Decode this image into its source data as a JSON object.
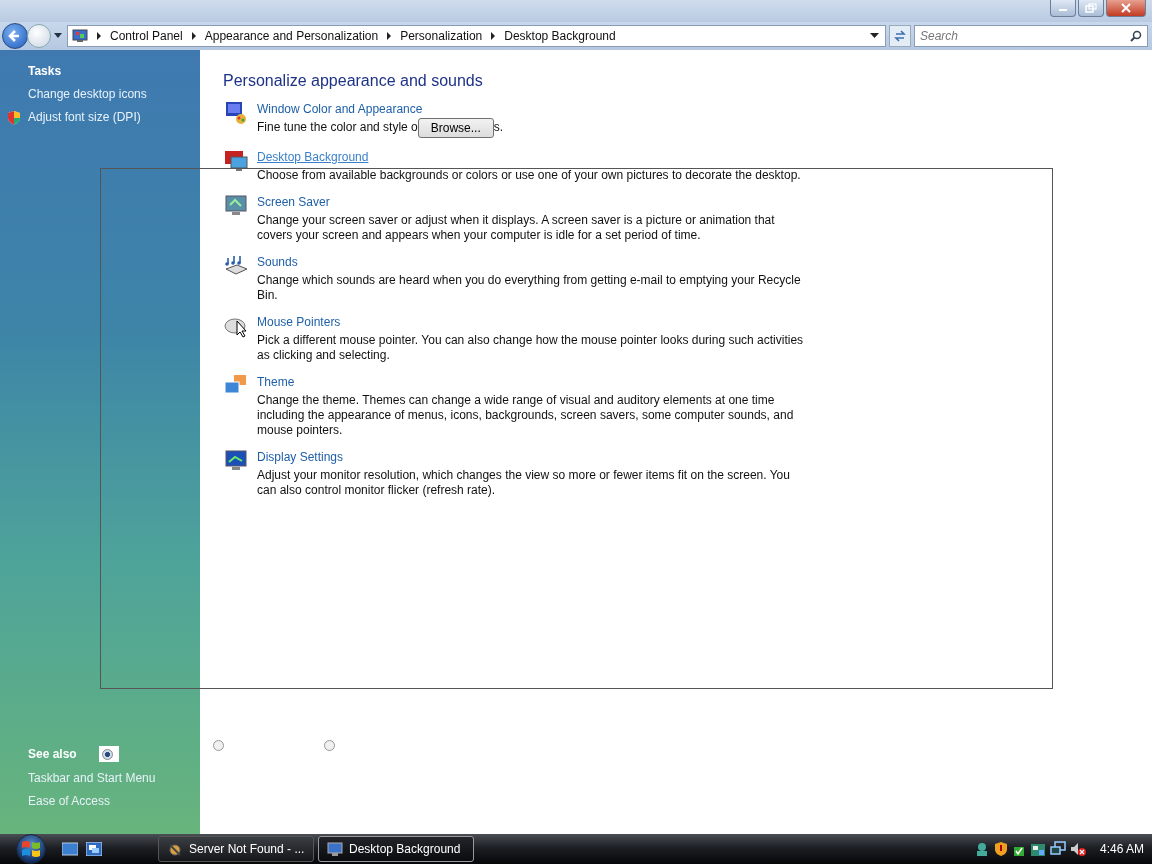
{
  "address_bar": {
    "crumbs": [
      "Control Panel",
      "Appearance and Personalization",
      "Personalization",
      "Desktop Background"
    ]
  },
  "search": {
    "placeholder": "Search"
  },
  "sidebar": {
    "tasks_title": "Tasks",
    "tasks": [
      {
        "label": "Change desktop icons",
        "shield": false
      },
      {
        "label": "Adjust font size (DPI)",
        "shield": true
      }
    ],
    "see_also_title": "See also",
    "see_also": [
      "Taskbar and Start Menu",
      "Ease of Access"
    ]
  },
  "content": {
    "title": "Personalize appearance and sounds",
    "items": [
      {
        "kind": "color",
        "title": "Window Color and Appearance",
        "hovered": false,
        "description": "Fine tune the color and style o",
        "description_tail": "s."
      },
      {
        "kind": "background",
        "title": "Desktop Background",
        "hovered": true,
        "description": "Choose from available backgrounds or colors or use one of your own pictures to decorate the desktop."
      },
      {
        "kind": "screensaver",
        "title": "Screen Saver",
        "hovered": false,
        "description": "Change your screen saver or adjust when it displays. A screen saver is a picture or animation that covers your screen and appears when your computer is idle for a set period of time."
      },
      {
        "kind": "sounds",
        "title": "Sounds",
        "hovered": false,
        "description": "Change which sounds are heard when you do everything from getting e-mail to emptying your Recycle Bin."
      },
      {
        "kind": "mouse",
        "title": "Mouse Pointers",
        "hovered": false,
        "description": "Pick a different mouse pointer. You can also change how the mouse pointer looks during such activities as clicking and selecting."
      },
      {
        "kind": "theme",
        "title": "Theme",
        "hovered": false,
        "description": "Change the theme. Themes can change a wide range of visual and auditory elements at one time including the appearance of menus, icons, backgrounds, screen savers, some computer sounds, and mouse pointers."
      },
      {
        "kind": "display",
        "title": "Display Settings",
        "hovered": false,
        "description": "Adjust your monitor resolution, which changes the view so more or fewer items fit on the screen. You can also control monitor flicker (refresh rate)."
      }
    ],
    "browse_button": "Browse...",
    "radio_buttons": [
      {
        "selected": true
      },
      {
        "selected": false
      },
      {
        "selected": false
      }
    ]
  },
  "taskbar": {
    "tasks": [
      {
        "label": "Server Not Found - ...",
        "selected": false
      },
      {
        "label": "Desktop Background",
        "selected": true
      }
    ],
    "clock": "4:46 AM"
  }
}
